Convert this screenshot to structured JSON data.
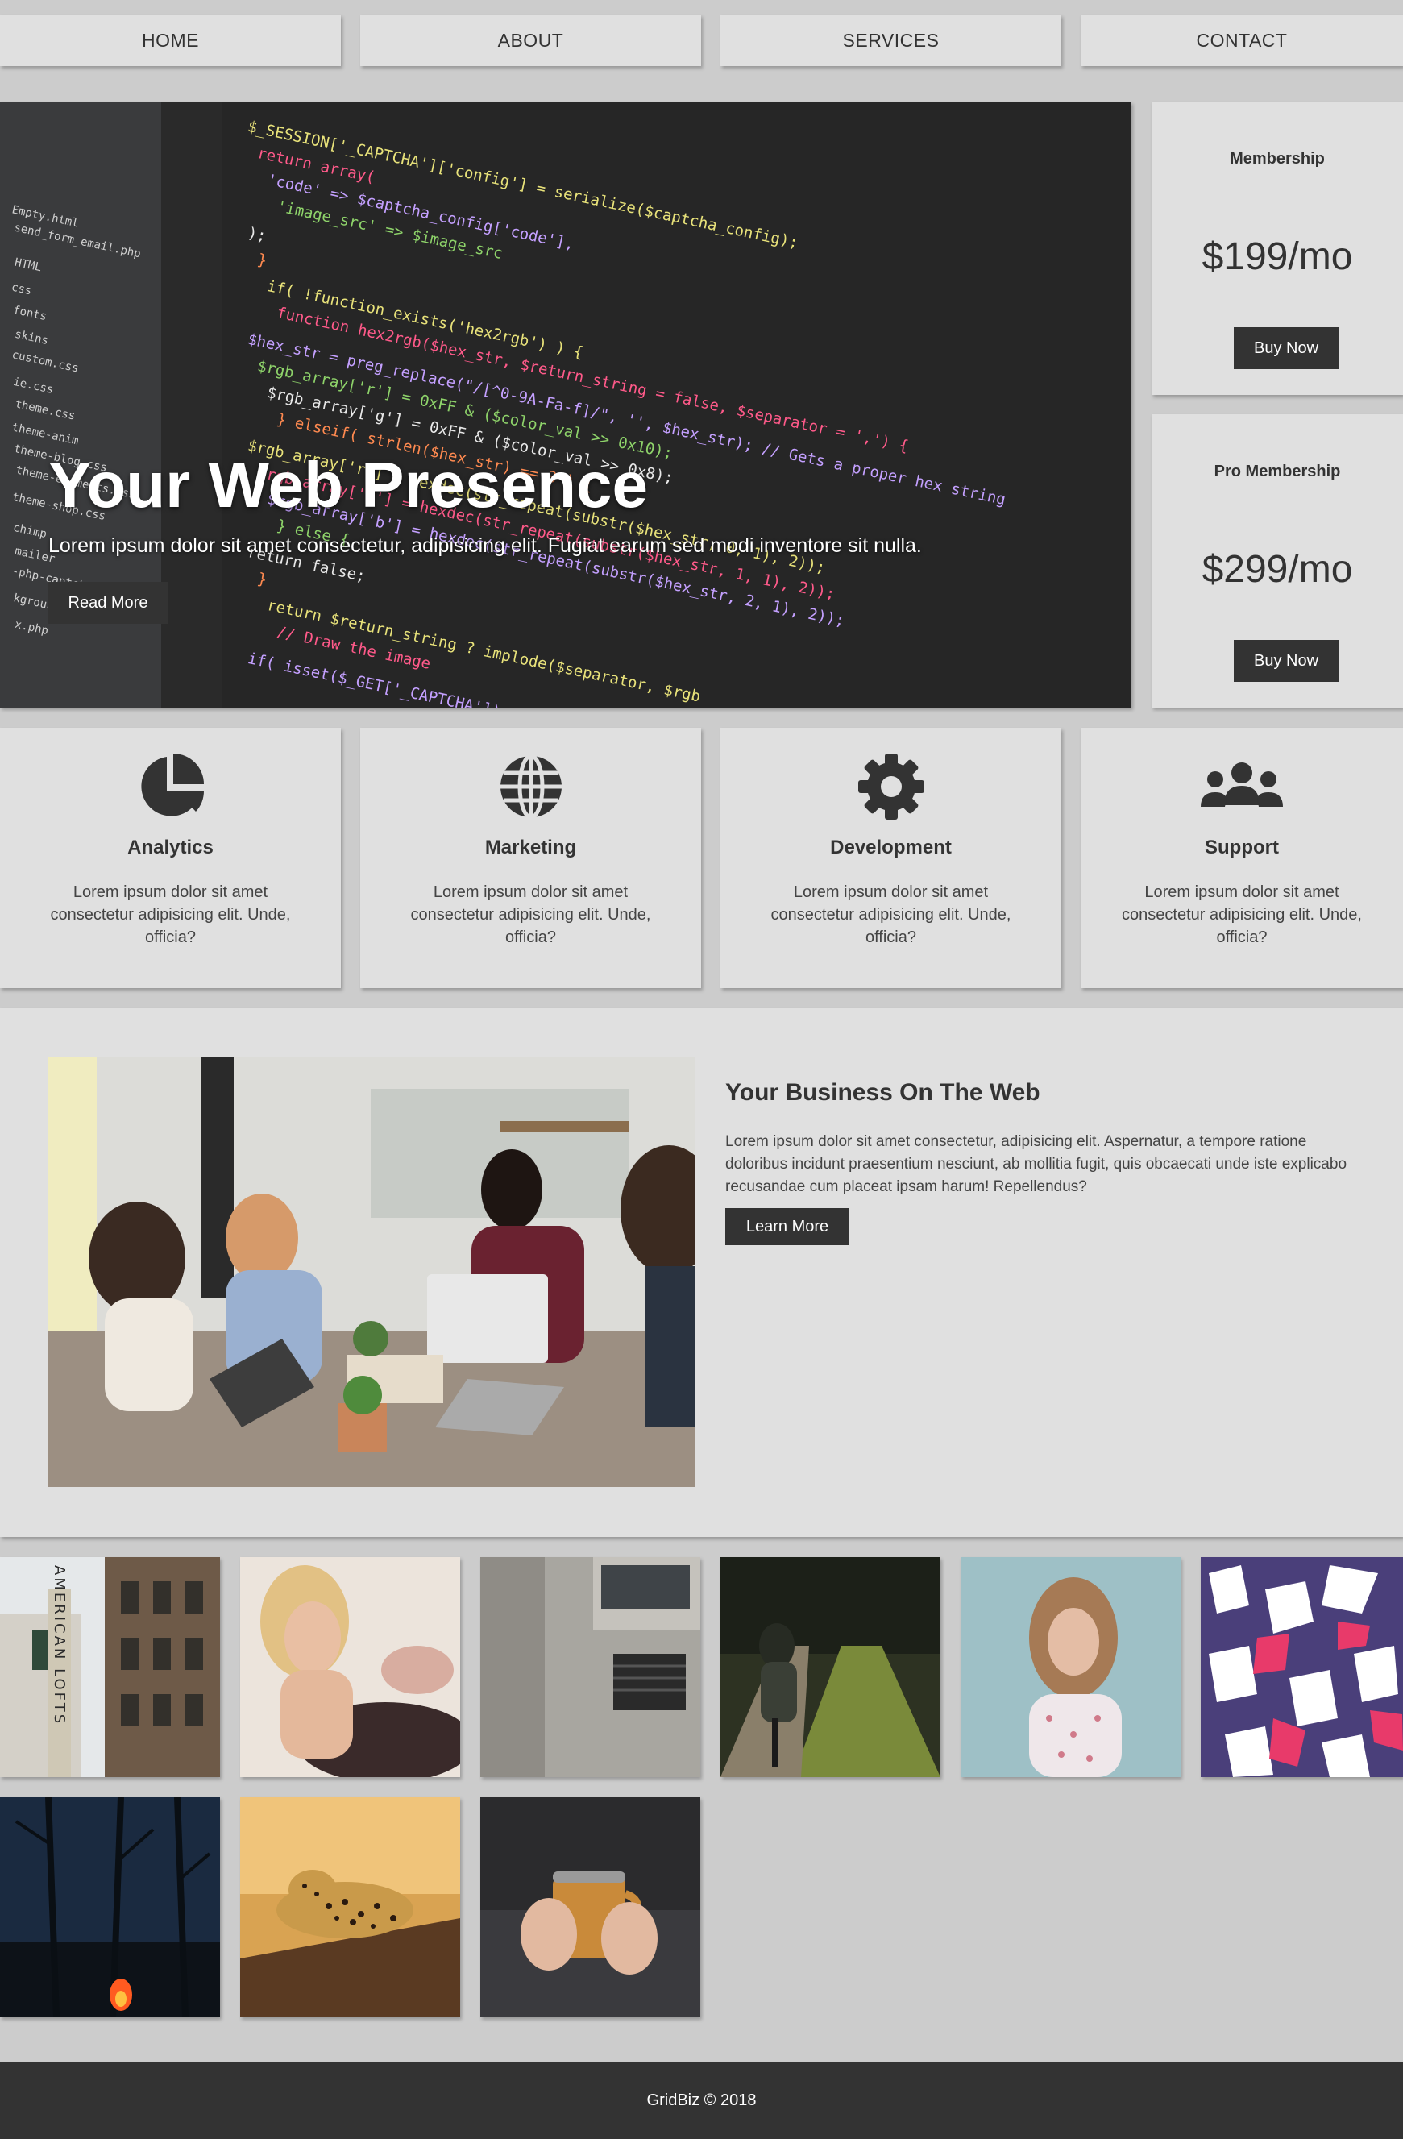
{
  "nav": {
    "items": [
      {
        "label": "HOME"
      },
      {
        "label": "ABOUT"
      },
      {
        "label": "SERVICES"
      },
      {
        "label": "CONTACT"
      }
    ]
  },
  "hero": {
    "title": "Your Web Presence",
    "subtitle": "Lorem ipsum dolor sit amet consectetur, adipisicing elit. Fugiat earum sed modi inventore sit nulla.",
    "button_label": "Read More"
  },
  "pricing": [
    {
      "name": "Membership",
      "price": "$199/mo",
      "button_label": "Buy Now"
    },
    {
      "name": "Pro Membership",
      "price": "$299/mo",
      "button_label": "Buy Now"
    }
  ],
  "features": [
    {
      "icon": "pie-chart-icon",
      "title": "Analytics",
      "text": "Lorem ipsum dolor sit amet consectetur adipisicing elit. Unde, officia?"
    },
    {
      "icon": "globe-icon",
      "title": "Marketing",
      "text": "Lorem ipsum dolor sit amet consectetur adipisicing elit. Unde, officia?"
    },
    {
      "icon": "gear-icon",
      "title": "Development",
      "text": "Lorem ipsum dolor sit amet consectetur adipisicing elit. Unde, officia?"
    },
    {
      "icon": "users-icon",
      "title": "Support",
      "text": "Lorem ipsum dolor sit amet consectetur adipisicing elit. Unde, officia?"
    }
  ],
  "business": {
    "title": "Your Business On The Web",
    "text": "Lorem ipsum dolor sit amet consectetur, adipisicing elit. Aspernatur, a tempore ratione doloribus incidunt praesentium nesciunt, ab mollitia fugit, quis obcaecati unde iste explicabo recusandae cum placeat ipsam harum! Repellendus?",
    "button_label": "Learn More"
  },
  "hero_code": {
    "sidebar_files": [
      "Empty.html",
      "send_form_email.php",
      "HTML",
      "css",
      "fonts",
      "skins",
      "custom.css",
      "ie.css",
      "theme.css",
      "theme-anim",
      "theme-blog.css",
      "theme-elements.css",
      "theme-shop.css",
      "chimp",
      "mailer",
      "-php-captcha",
      "kgrounds",
      "x.php"
    ],
    "lines": [
      "$_SESSION['_CAPTCHA']['config'] = serialize($captcha_config);",
      "return array(",
      "'code' => $captcha_config['code'],",
      "'image_src' => $image_src",
      ");",
      "}",
      "if( !function_exists('hex2rgb') ) {",
      "function hex2rgb($hex_str, $return_string = false, $separator = ',') {",
      "$hex_str = preg_replace(\"/[^0-9A-Fa-f]/\", '', $hex_str); // Gets a proper hex string",
      "$rgb_array['r'] = 0xFF & ($color_val >> 0x10);",
      "$rgb_array['g'] = 0xFF & ($color_val >> 0x8);",
      "} elseif( strlen($hex_str) == 3 ) {",
      "$rgb_array['r'] = hexdec(str_repeat(substr($hex_str, 0, 1), 2));",
      "$rgb_array['g'] = hexdec(str_repeat(substr($hex_str, 1, 1), 2));",
      "$rgb_array['b'] = hexdec(str_repeat(substr($hex_str, 2, 1), 2));",
      "} else {",
      "return false;",
      "}",
      "return $return_string ? implode($separator, $rgb",
      "// Draw the image",
      "if( isset($_GET['_CAPTCHA']) ) {"
    ]
  },
  "gallery": [
    {
      "alt": "American Lofts building"
    },
    {
      "alt": "Woman resting on couch"
    },
    {
      "alt": "Concrete building window"
    },
    {
      "alt": "Cyclist on path"
    },
    {
      "alt": "Woman in floral top"
    },
    {
      "alt": "Abstract mosaic pattern"
    },
    {
      "alt": "Night forest campfire"
    },
    {
      "alt": "Leopard on tree"
    },
    {
      "alt": "Hands holding mug"
    }
  ],
  "gallery_sign": "AMERICAN LOFTS",
  "footer": {
    "text": "GridBiz © 2018"
  },
  "colors": {
    "background": "#cccccc",
    "card": "#e0e0e0",
    "dark": "#333333"
  }
}
